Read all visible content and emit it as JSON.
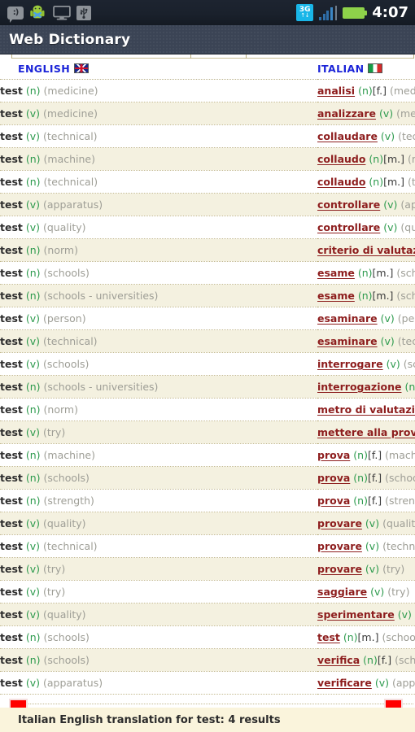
{
  "status_bar": {
    "icons_left": [
      "message-icon",
      "android-icon",
      "monitor-icon",
      "usb-icon"
    ],
    "message_glyph": ":)",
    "network_label": "3G",
    "network_arrows": "↑↓",
    "icons_right": [
      "3g-icon",
      "signal-icon",
      "battery-icon"
    ],
    "time": "4:07"
  },
  "titlebar": {
    "title": "Web Dictionary"
  },
  "table": {
    "headers": {
      "english": "ENGLISH",
      "italian": "ITALIAN",
      "english_flag": "uk-flag-icon",
      "italian_flag": "italy-flag-icon"
    },
    "rows": [
      {
        "en_word": "test",
        "en_pos": "(n)",
        "en_domain": "(medicine)",
        "it_word": "analisi",
        "it_pos": "(n)",
        "it_gender": "[f.]",
        "it_domain": "(med"
      },
      {
        "en_word": "test",
        "en_pos": "(v)",
        "en_domain": "(medicine)",
        "it_word": "analizzare",
        "it_pos": "(v)",
        "it_gender": "",
        "it_domain": "(medi"
      },
      {
        "en_word": "test",
        "en_pos": "(v)",
        "en_domain": "(technical)",
        "it_word": "collaudare",
        "it_pos": "(v)",
        "it_gender": "",
        "it_domain": "(tech"
      },
      {
        "en_word": "test",
        "en_pos": "(n)",
        "en_domain": "(machine)",
        "it_word": "collaudo",
        "it_pos": "(n)",
        "it_gender": "[m.]",
        "it_domain": "(m"
      },
      {
        "en_word": "test",
        "en_pos": "(n)",
        "en_domain": "(technical)",
        "it_word": "collaudo",
        "it_pos": "(n)",
        "it_gender": "[m.]",
        "it_domain": "(te"
      },
      {
        "en_word": "test",
        "en_pos": "(v)",
        "en_domain": "(apparatus)",
        "it_word": "controllare",
        "it_pos": "(v)",
        "it_gender": "",
        "it_domain": "(app"
      },
      {
        "en_word": "test",
        "en_pos": "(v)",
        "en_domain": "(quality)",
        "it_word": "controllare",
        "it_pos": "(v)",
        "it_gender": "",
        "it_domain": "(qua"
      },
      {
        "en_word": "test",
        "en_pos": "(n)",
        "en_domain": "(norm)",
        "it_word": "criterio di valutazi",
        "it_pos": "",
        "it_gender": "",
        "it_domain": ""
      },
      {
        "en_word": "test",
        "en_pos": "(n)",
        "en_domain": "(schools)",
        "it_word": "esame",
        "it_pos": "(n)",
        "it_gender": "[m.]",
        "it_domain": "(sch"
      },
      {
        "en_word": "test",
        "en_pos": "(n)",
        "en_domain": "(schools - universities)",
        "it_word": "esame",
        "it_pos": "(n)",
        "it_gender": "[m.]",
        "it_domain": "(sch"
      },
      {
        "en_word": "test",
        "en_pos": "(v)",
        "en_domain": "(person)",
        "it_word": "esaminare",
        "it_pos": "(v)",
        "it_gender": "",
        "it_domain": "(pers"
      },
      {
        "en_word": "test",
        "en_pos": "(v)",
        "en_domain": "(technical)",
        "it_word": "esaminare",
        "it_pos": "(v)",
        "it_gender": "",
        "it_domain": "(tech"
      },
      {
        "en_word": "test",
        "en_pos": "(v)",
        "en_domain": "(schools)",
        "it_word": "interrogare",
        "it_pos": "(v)",
        "it_gender": "",
        "it_domain": "(sch"
      },
      {
        "en_word": "test",
        "en_pos": "(n)",
        "en_domain": "(schools - universities)",
        "it_word": "interrogazione",
        "it_pos": "(n)",
        "it_gender": "",
        "it_domain": ""
      },
      {
        "en_word": "test",
        "en_pos": "(n)",
        "en_domain": "(norm)",
        "it_word": "metro di valutazio",
        "it_pos": "",
        "it_gender": "",
        "it_domain": ""
      },
      {
        "en_word": "test",
        "en_pos": "(v)",
        "en_domain": "(try)",
        "it_word": "mettere alla prova",
        "it_pos": "",
        "it_gender": "",
        "it_domain": ""
      },
      {
        "en_word": "test",
        "en_pos": "(n)",
        "en_domain": "(machine)",
        "it_word": "prova",
        "it_pos": "(n)",
        "it_gender": "[f.]",
        "it_domain": "(machi"
      },
      {
        "en_word": "test",
        "en_pos": "(n)",
        "en_domain": "(schools)",
        "it_word": "prova",
        "it_pos": "(n)",
        "it_gender": "[f.]",
        "it_domain": "(schoo"
      },
      {
        "en_word": "test",
        "en_pos": "(n)",
        "en_domain": "(strength)",
        "it_word": "prova",
        "it_pos": "(n)",
        "it_gender": "[f.]",
        "it_domain": "(streng"
      },
      {
        "en_word": "test",
        "en_pos": "(v)",
        "en_domain": "(quality)",
        "it_word": "provare",
        "it_pos": "(v)",
        "it_gender": "",
        "it_domain": "(quality)"
      },
      {
        "en_word": "test",
        "en_pos": "(v)",
        "en_domain": "(technical)",
        "it_word": "provare",
        "it_pos": "(v)",
        "it_gender": "",
        "it_domain": "(technica"
      },
      {
        "en_word": "test",
        "en_pos": "(v)",
        "en_domain": "(try)",
        "it_word": "provare",
        "it_pos": "(v)",
        "it_gender": "",
        "it_domain": "(try)"
      },
      {
        "en_word": "test",
        "en_pos": "(v)",
        "en_domain": "(try)",
        "it_word": "saggiare",
        "it_pos": "(v)",
        "it_gender": "",
        "it_domain": "(try)"
      },
      {
        "en_word": "test",
        "en_pos": "(v)",
        "en_domain": "(quality)",
        "it_word": "sperimentare",
        "it_pos": "(v)",
        "it_gender": "",
        "it_domain": "(q"
      },
      {
        "en_word": "test",
        "en_pos": "(n)",
        "en_domain": "(schools)",
        "it_word": "test",
        "it_pos": "(n)",
        "it_gender": "[m.]",
        "it_domain": "(school"
      },
      {
        "en_word": "test",
        "en_pos": "(n)",
        "en_domain": "(schools)",
        "it_word": "verifica",
        "it_pos": "(n)",
        "it_gender": "[f.]",
        "it_domain": "(sch"
      },
      {
        "en_word": "test",
        "en_pos": "(v)",
        "en_domain": "(apparatus)",
        "it_word": "verificare",
        "it_pos": "(v)",
        "it_gender": "",
        "it_domain": "(appar"
      }
    ]
  },
  "markers": {
    "left_marker": "red-marker-left",
    "right_marker": "red-marker-right"
  },
  "footer": {
    "note": "Italian English translation for test: 4 results"
  },
  "colors": {
    "header_link": "#1b24d8",
    "english_word": "#2e2e2e",
    "pos_green": "#2e9b4e",
    "domain_gray": "#9e9e96",
    "italian_word": "#8d1d1d",
    "row_alt": "#f4f1e0",
    "footer_bg": "#faf4dc",
    "marker_red": "#ff0000",
    "titlebar_bg": "#3b4455",
    "statusbar_bg": "#1a212c"
  }
}
